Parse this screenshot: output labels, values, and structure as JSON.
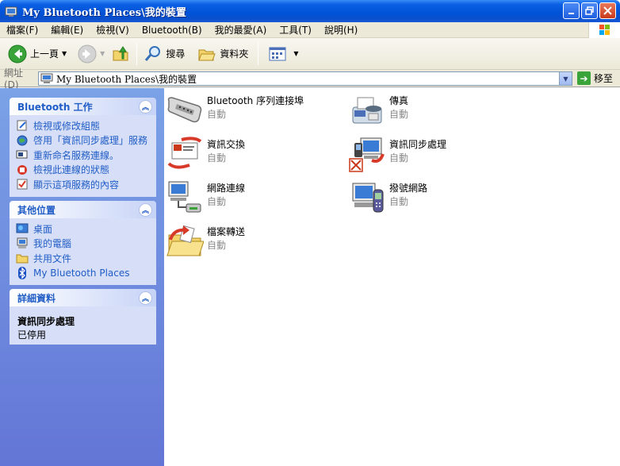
{
  "window": {
    "title": "My Bluetooth Places\\我的裝置"
  },
  "menu": [
    "檔案(F)",
    "編輯(E)",
    "檢視(V)",
    "Bluetooth(B)",
    "我的最愛(A)",
    "工具(T)",
    "說明(H)"
  ],
  "toolbar": {
    "back": "上一頁",
    "search": "搜尋",
    "folders": "資料夾"
  },
  "address": {
    "label": "網址(D)",
    "value": "My Bluetooth Places\\我的裝置",
    "go": "移至"
  },
  "tasks_panel": {
    "title": "Bluetooth 工作",
    "items": [
      "檢視或修改組態",
      "啓用「資訊同步處理」服務",
      "重新命名服務連線。",
      "檢視此連線的狀態",
      "顯示這項服務的內容"
    ]
  },
  "places_panel": {
    "title": "其他位置",
    "items": [
      "桌面",
      "我的電腦",
      "共用文件",
      "My Bluetooth Places"
    ]
  },
  "details_panel": {
    "title": "詳細資料",
    "name": "資訊同步處理",
    "status": "已停用"
  },
  "items": [
    {
      "name": "Bluetooth 序列連接埠",
      "status": "自動"
    },
    {
      "name": "傳真",
      "status": "自動"
    },
    {
      "name": "資訊交換",
      "status": "自動"
    },
    {
      "name": "資訊同步處理",
      "status": "自動"
    },
    {
      "name": "網路連線",
      "status": "自動"
    },
    {
      "name": "撥號網路",
      "status": "自動"
    },
    {
      "name": "檔案轉送",
      "status": "自動"
    }
  ]
}
